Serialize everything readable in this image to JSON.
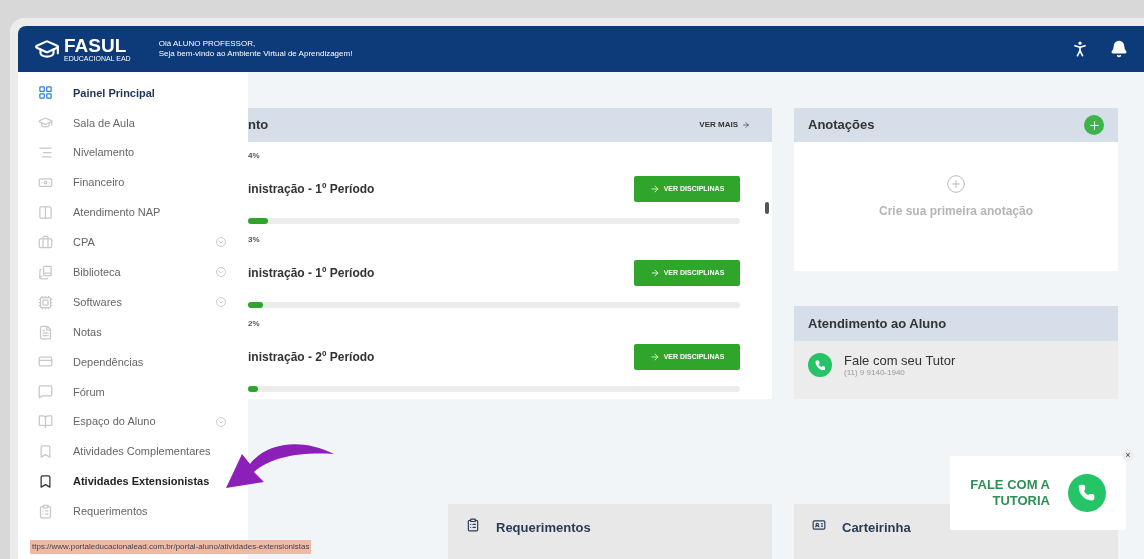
{
  "header": {
    "logo": "FASUL",
    "logo_sub": "EDUCACIONAL EAD",
    "greeting": "Olá ALUNO PROFESSOR,",
    "welcome": "Seja bem-vindo ao Ambiente Virtual de Aprendizagem!"
  },
  "sidebar": {
    "items": [
      {
        "label": "Painel Principal",
        "selected": true,
        "hovered": false,
        "expandable": false
      },
      {
        "label": "Sala de Aula",
        "selected": false,
        "hovered": false,
        "expandable": false
      },
      {
        "label": "Nivelamento",
        "selected": false,
        "hovered": false,
        "expandable": false
      },
      {
        "label": "Financeiro",
        "selected": false,
        "hovered": false,
        "expandable": false
      },
      {
        "label": "Atendimento NAP",
        "selected": false,
        "hovered": false,
        "expandable": false
      },
      {
        "label": "CPA",
        "selected": false,
        "hovered": false,
        "expandable": true
      },
      {
        "label": "Biblioteca",
        "selected": false,
        "hovered": false,
        "expandable": true
      },
      {
        "label": "Softwares",
        "selected": false,
        "hovered": false,
        "expandable": true
      },
      {
        "label": "Notas",
        "selected": false,
        "hovered": false,
        "expandable": false
      },
      {
        "label": "Dependências",
        "selected": false,
        "hovered": false,
        "expandable": false
      },
      {
        "label": "Fórum",
        "selected": false,
        "hovered": false,
        "expandable": false
      },
      {
        "label": "Espaço do Aluno",
        "selected": false,
        "hovered": false,
        "expandable": true
      },
      {
        "label": "Atividades Complementares",
        "selected": false,
        "hovered": false,
        "expandable": false
      },
      {
        "label": "Atividades Extensionistas",
        "selected": false,
        "hovered": true,
        "expandable": false
      },
      {
        "label": "Requerimentos",
        "selected": false,
        "hovered": false,
        "expandable": false
      }
    ]
  },
  "courses": {
    "title": "nto",
    "more": "VER MAIS",
    "items": [
      {
        "progress": "4%",
        "name": "inistração - 1º Período",
        "button": "VER DISCIPLINAS",
        "level": 0.04
      },
      {
        "progress": "3%",
        "name": "inistração - 1º Período",
        "button": "VER DISCIPLINAS",
        "level": 0.03
      },
      {
        "progress": "2%",
        "name": "inistração - 2º Período",
        "button": "VER DISCIPLINAS",
        "level": 0.02
      }
    ]
  },
  "notes": {
    "title": "Anotações",
    "empty": "Crie sua primeira anotação"
  },
  "support": {
    "title": "Atendimento ao Aluno",
    "contact": "Fale com seu Tutor",
    "phone": "(11) 9 9140-1940"
  },
  "bottom_cards": [
    {
      "title": "Requerimentos"
    },
    {
      "title": "Carteirinha"
    }
  ],
  "tutor_popup": {
    "text": "FALE COM A TUTORIA",
    "close": "×"
  },
  "status_url": "ttps://www.portaleducacionalead.com.br/portal-aluno/atividades-extensionistas"
}
